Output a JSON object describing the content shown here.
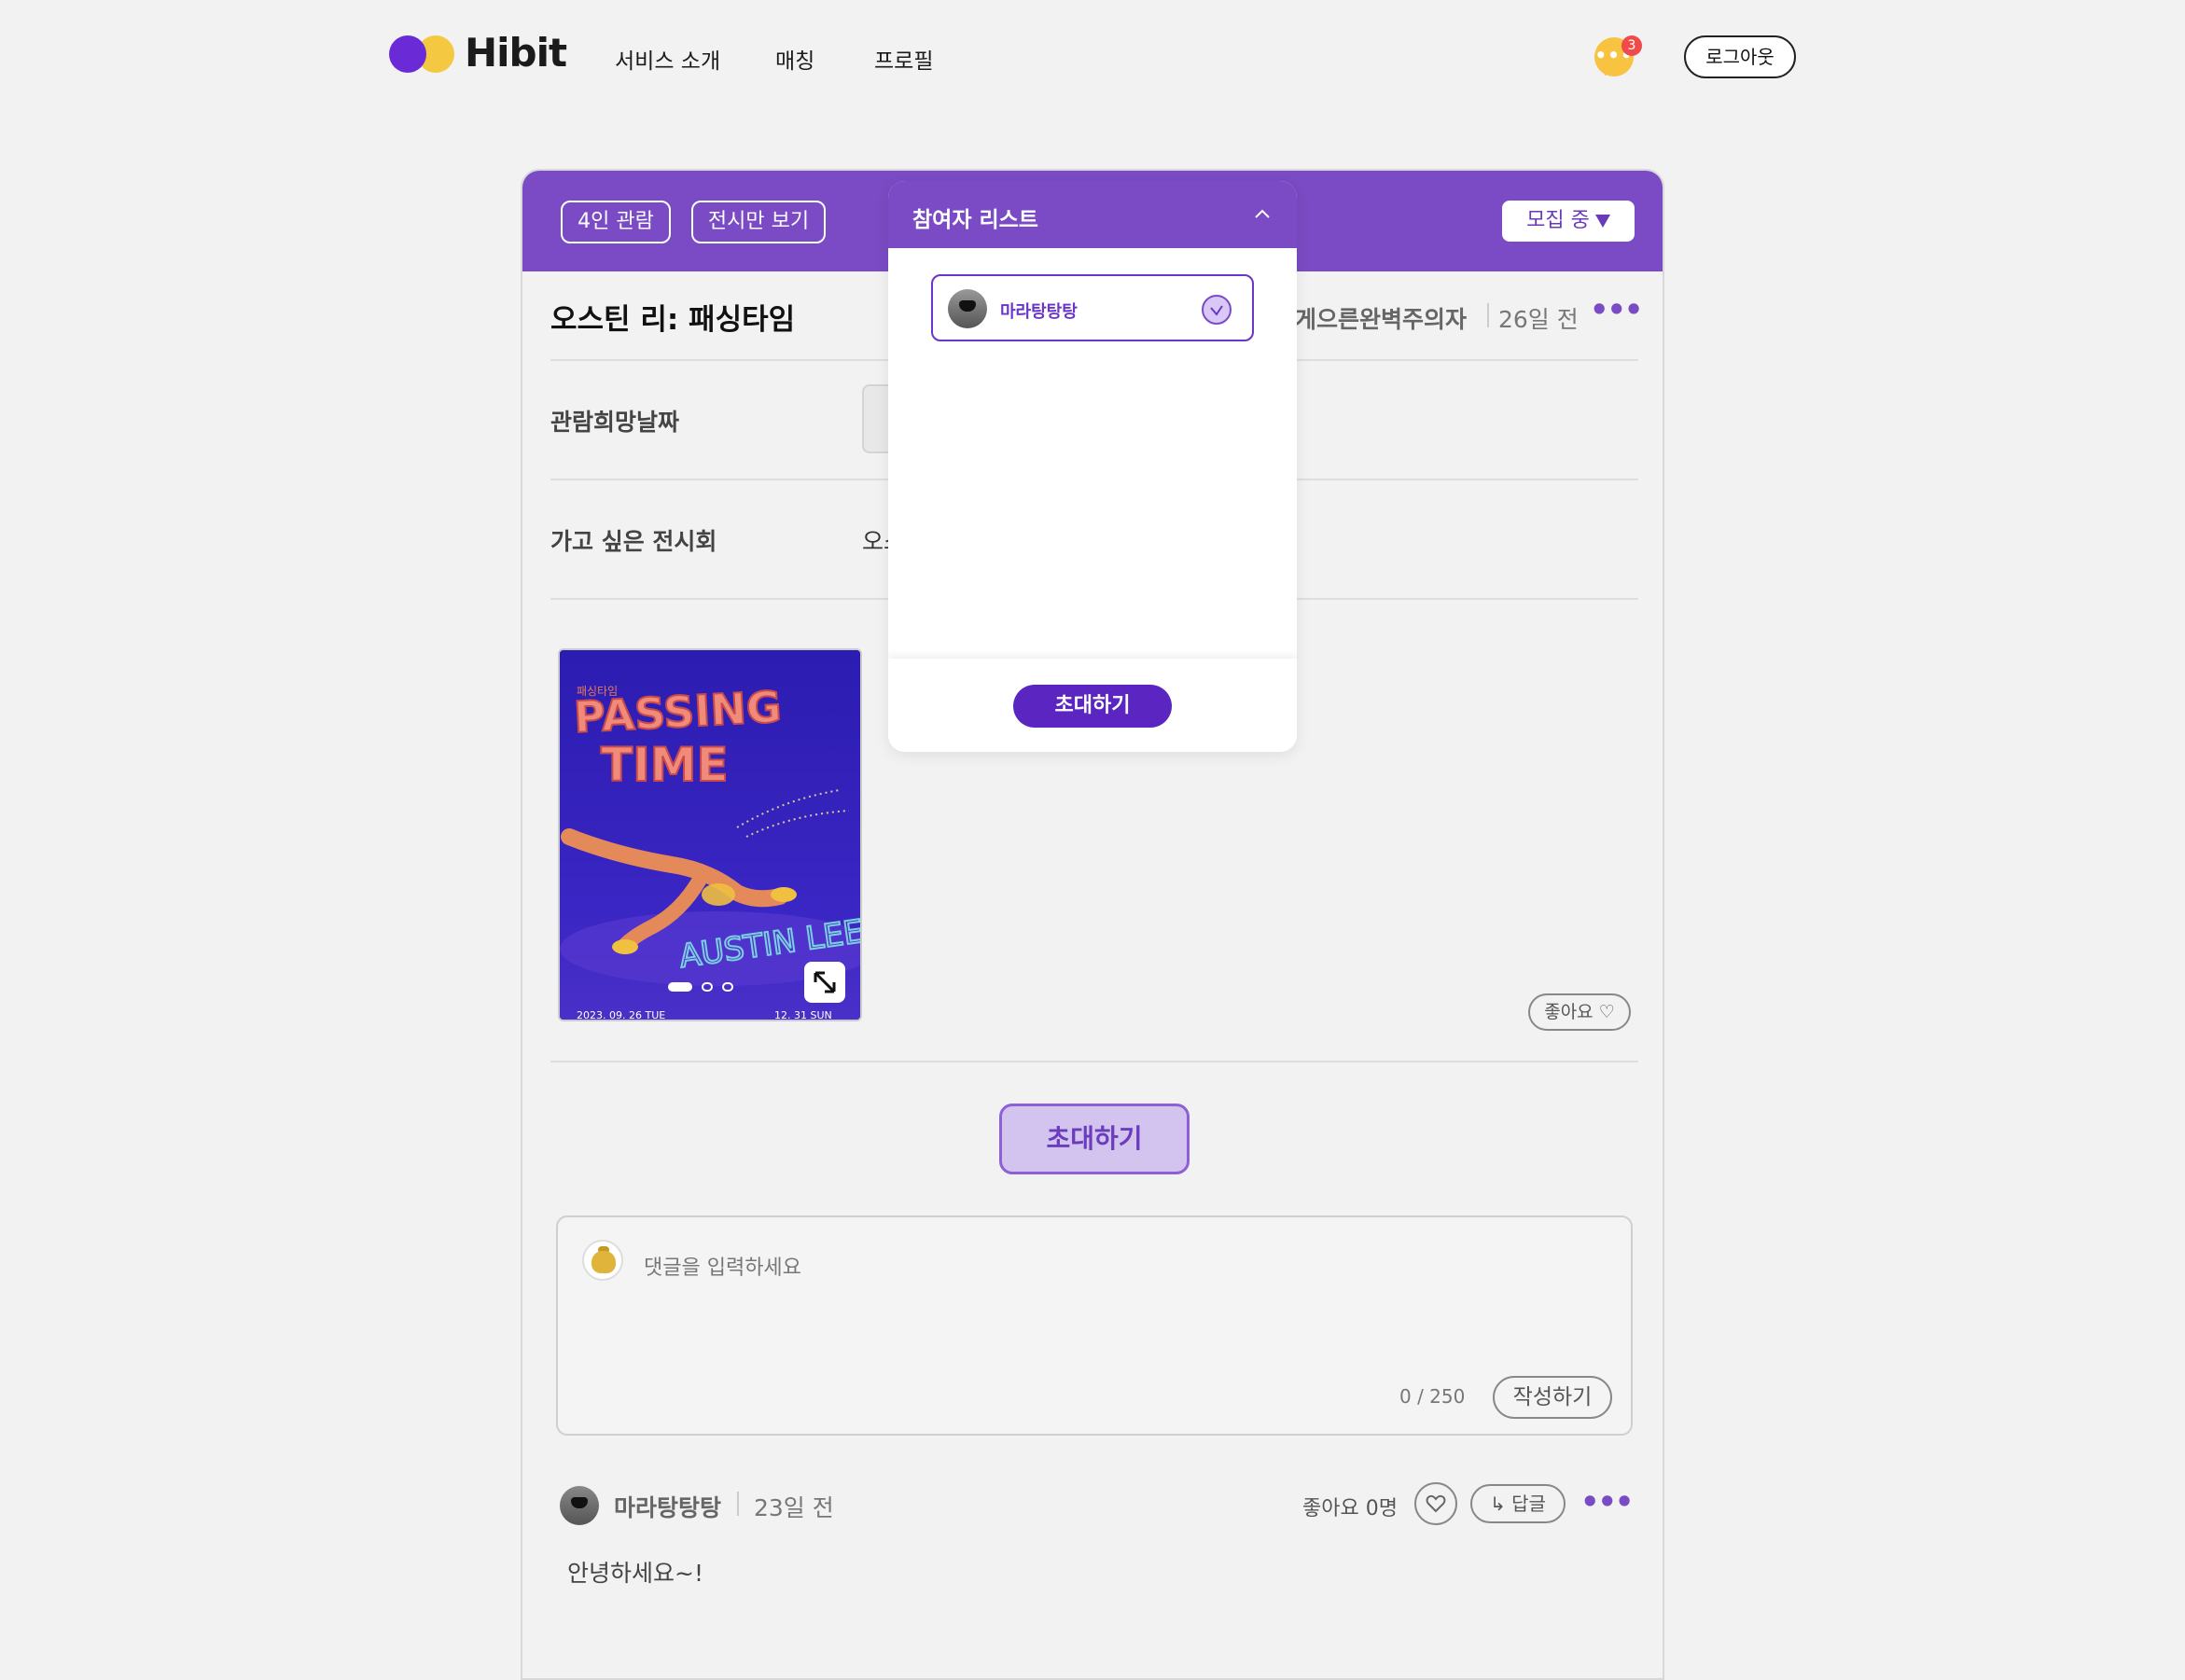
{
  "header": {
    "logo_text": "Hibit",
    "nav": [
      "서비스 소개",
      "매칭",
      "프로필"
    ],
    "chat_badge_count": "3",
    "logout_label": "로그아웃"
  },
  "post": {
    "chips": [
      "4인 관람",
      "전시만 보기"
    ],
    "status_label": "모집 중",
    "title": "오스틴 리: 패싱타임",
    "author": "게으른완벽주의자",
    "time": "26일 전",
    "rows": [
      {
        "label": "관람희망날짜",
        "value": ""
      },
      {
        "label": "가고 싶은 전시회",
        "value": "오스"
      }
    ],
    "poster": {
      "top_small": "패싱타임",
      "title_line1": "PASSING",
      "title_line2": "TIME",
      "artist": "AUSTIN LEE",
      "date_left": "2023. 09. 26 TUE",
      "date_right": "12. 31 SUN"
    },
    "like_label": "좋아요",
    "invite_label": "초대하기"
  },
  "comment_input": {
    "placeholder": "댓글을  입력하세요",
    "counter": "0 / 250",
    "submit_label": "작성하기"
  },
  "comments": [
    {
      "author": "마라탕탕탕",
      "time": "23일 전",
      "likes": "좋아요 0명",
      "reply_label": "답글",
      "text": "안녕하세요~!"
    }
  ],
  "participant_panel": {
    "title": "참여자 리스트",
    "participants": [
      {
        "name": "마라탕탕탕",
        "selected": true
      }
    ],
    "invite_label": "초대하기"
  },
  "colors": {
    "primary_purple": "#7a4bc4",
    "deep_purple": "#5a25c0",
    "logo_yellow": "#f5c842",
    "badge_red": "#ef4b4b"
  }
}
